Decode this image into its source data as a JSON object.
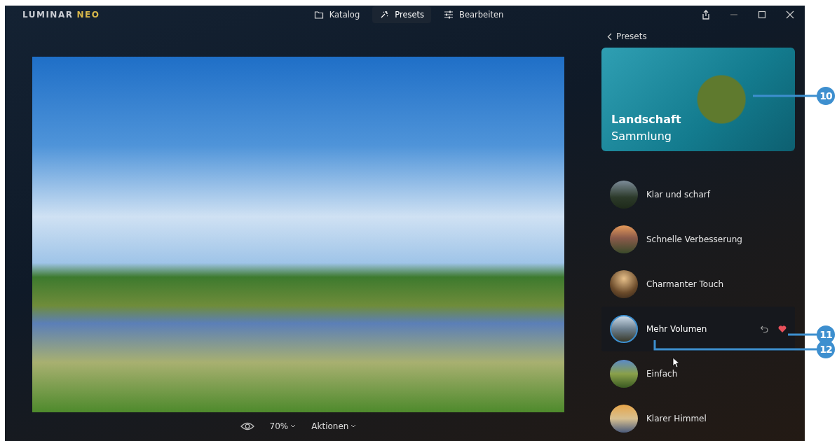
{
  "logo": {
    "primary": "LUMINAR",
    "secondary": "NEO"
  },
  "nav_tabs": [
    {
      "label": "Katalog",
      "kind": "catalog",
      "selected": false
    },
    {
      "label": "Presets",
      "kind": "presets",
      "selected": true
    },
    {
      "label": "Bearbeiten",
      "kind": "edit",
      "selected": false
    }
  ],
  "toolbar": {
    "zoom": "70%",
    "actions": "Aktionen"
  },
  "panel": {
    "back": "Presets",
    "collection": {
      "title": "Landschaft",
      "subtitle": "Sammlung"
    },
    "presets": [
      {
        "name": "Klar und scharf",
        "selected": false
      },
      {
        "name": "Schnelle Verbesserung",
        "selected": false
      },
      {
        "name": "Charmanter Touch",
        "selected": false
      },
      {
        "name": "Mehr Volumen",
        "selected": true
      },
      {
        "name": "Einfach",
        "selected": false
      },
      {
        "name": "Klarer Himmel",
        "selected": false
      }
    ]
  },
  "callouts": [
    {
      "number": "10",
      "kind": "card"
    },
    {
      "number": "11",
      "kind": "heart"
    },
    {
      "number": "12",
      "kind": "label"
    }
  ]
}
